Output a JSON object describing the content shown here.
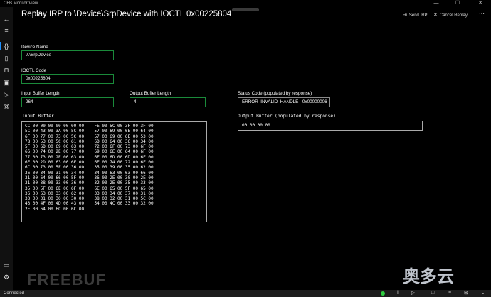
{
  "window": {
    "title": "CFB Monitor View",
    "minimize": "—",
    "maximize": "☐",
    "close": "✕"
  },
  "sidebar": {
    "icons": [
      "menu-icon",
      "braces-icon",
      "file-icon",
      "pin-icon",
      "device-icon",
      "forward-icon",
      "at-icon"
    ],
    "glyphs": [
      "≡",
      "{}",
      "▯",
      "⊓",
      "▣",
      "▷",
      "@"
    ],
    "bottom_glyphs": [
      "▭",
      "⚙"
    ]
  },
  "header": {
    "back": "←",
    "title": "Replay IRP to \\Device\\SrpDevice with IOCTL 0x00225804",
    "send_irp": "Send IRP",
    "cancel_replay": "Cancel Replay",
    "more": "⋯"
  },
  "form": {
    "device_name_label": "Device Name",
    "device_name_value": "\\\\.\\SrpDevice",
    "ioctl_code_label": "IOCTL Code",
    "ioctl_code_value": "0x00225804",
    "input_len_label": "Input Buffer Length",
    "input_len_value": "264",
    "output_len_label": "Output Buffer Length",
    "output_len_value": "4",
    "status_code_label": "Status Code (populated by response)",
    "status_code_value": "ERROR_INVALID_HANDLE - 0x00000006",
    "input_buffer_label": "Input Buffer",
    "output_buffer_label": "Output Buffer (populated by response)",
    "output_buffer_value": "00 00 00 00"
  },
  "input_buffer_lines": [
    "CC 00 00 00 00 00 00 00    FE 00 5C 00 3F 00 3F 00",
    "5C 00 43 00 3A 00 5C 00    57 00 69 00 6E 00 64 00",
    "6F 00 77 00 73 00 5C 00    57 00 69 00 6E 00 53 00",
    "78 00 53 00 5C 00 61 00    6D 00 64 00 36 00 34 00",
    "5F 00 6D 00 69 00 63 00    72 00 6F 00 73 00 6F 00",
    "66 00 74 00 2E 00 77 00    69 00 6E 00 64 00 6F 00",
    "77 00 73 00 2E 00 63 00    6F 00 6D 00 6D 00 6F 00",
    "6E 00 2D 00 63 00 6F 00    6E 00 74 00 72 00 6F 00",
    "6C 00 73 00 5F 00 36 00    35 00 39 00 35 00 62 00",
    "36 00 34 00 31 00 34 00    34 00 63 00 63 00 66 00",
    "31 00 64 00 66 00 5F 00    36 00 2E 00 30 00 2E 00",
    "31 00 38 00 33 00 36 00    32 00 2E 00 35 00 33 00",
    "35 00 5F 00 6E 00 6F 00    6E 00 65 00 5F 00 65 00",
    "36 00 63 00 33 00 62 00    33 00 34 00 37 00 31 00",
    "33 00 31 00 30 00 30 00    38 00 32 00 31 00 5C 00",
    "43 00 4F 00 4D 00 43 00    54 00 4C 00 33 00 32 00",
    "2E 00 64 00 6C 00 6C 00"
  ],
  "statusbar": {
    "text": "Connected"
  },
  "watermark": {
    "left": "FREEBUF",
    "right": "奥多云"
  }
}
